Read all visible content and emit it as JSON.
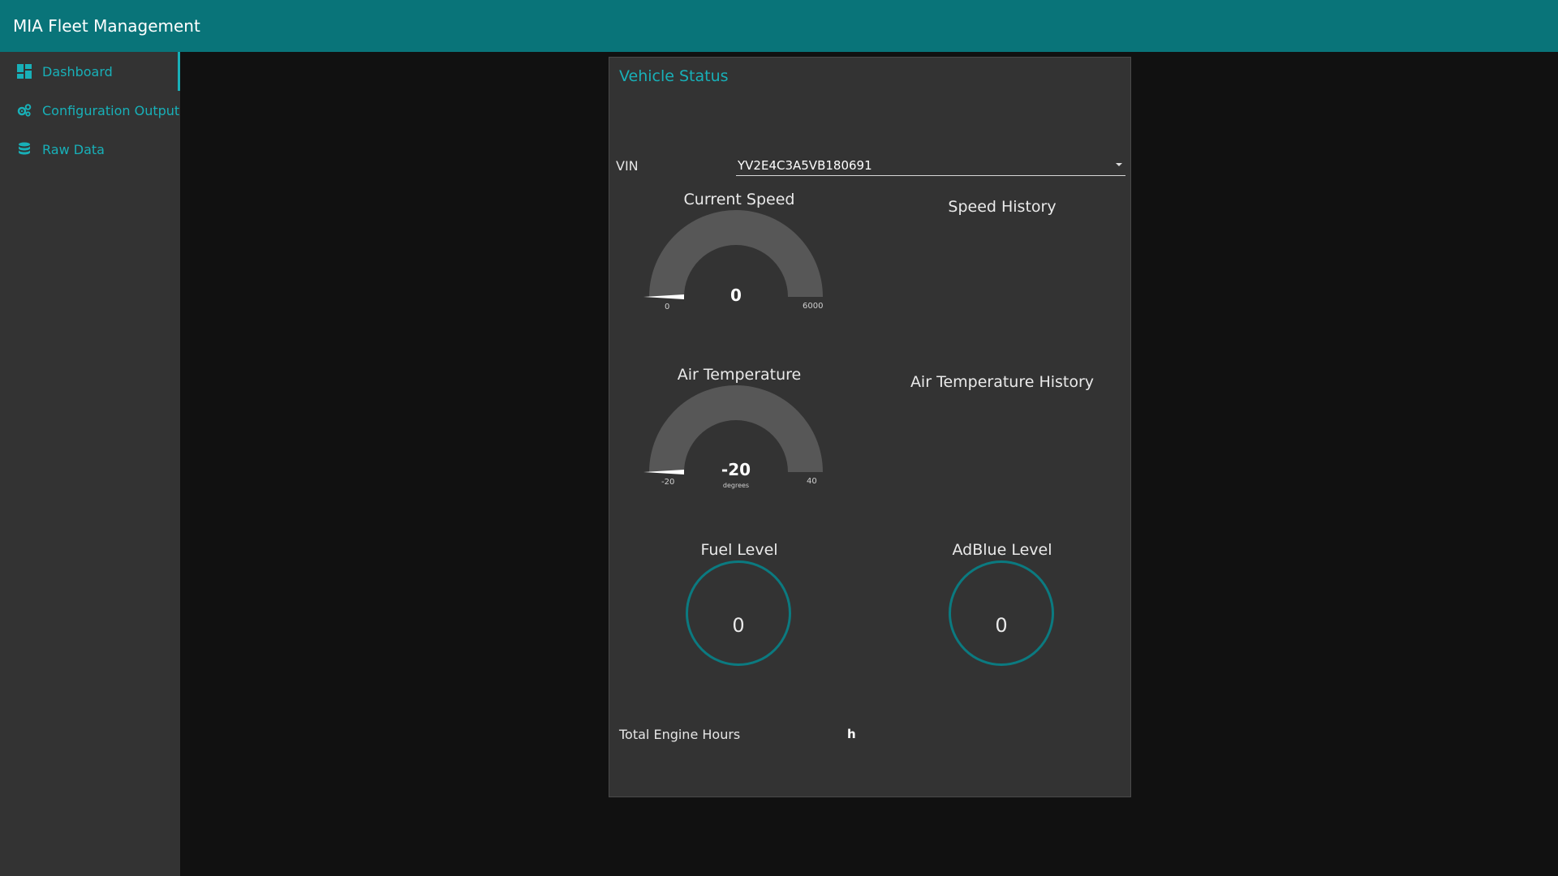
{
  "header": {
    "title": "MIA Fleet Management"
  },
  "sidebar": {
    "items": [
      {
        "label": "Dashboard",
        "icon": "dashboard-icon",
        "active": true
      },
      {
        "label": "Configuration Output",
        "icon": "gears-icon",
        "active": false
      },
      {
        "label": "Raw Data",
        "icon": "database-icon",
        "active": false
      }
    ]
  },
  "panel": {
    "title": "Vehicle Status",
    "vin": {
      "label": "VIN",
      "value": "YV2E4C3A5VB180691"
    },
    "speed": {
      "title": "Current Speed",
      "value": "0",
      "min": "0",
      "max": "6000",
      "unit": ""
    },
    "speed_history": {
      "title": "Speed History"
    },
    "air_temp": {
      "title": "Air Temperature",
      "value": "-20",
      "min": "-20",
      "max": "40",
      "unit": "degrees"
    },
    "air_temp_history": {
      "title": "Air Temperature History"
    },
    "fuel": {
      "title": "Fuel Level",
      "value": "0"
    },
    "adblue": {
      "title": "AdBlue Level",
      "value": "0"
    },
    "engine_hours": {
      "label": "Total Engine Hours",
      "unit": "h"
    }
  },
  "colors": {
    "accent": "#18b0b8",
    "header": "#097479",
    "panel": "#333333",
    "background": "#111111",
    "gauge_track": "#575757",
    "ring": "#0b7a80"
  }
}
